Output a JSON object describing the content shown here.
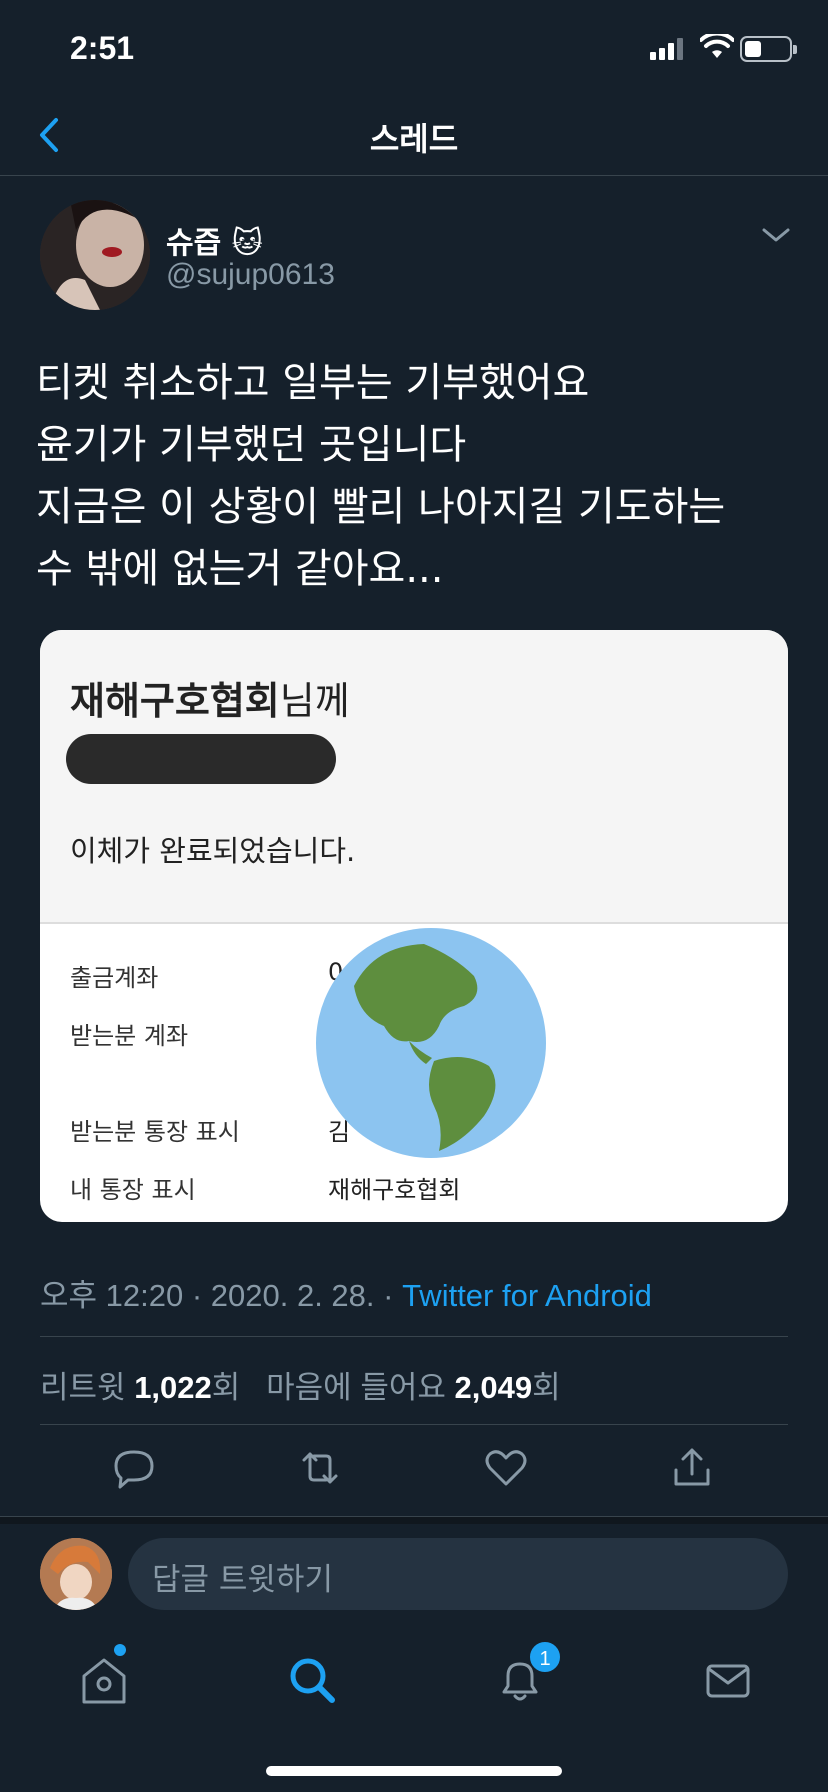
{
  "status_bar": {
    "time": "2:51"
  },
  "nav": {
    "title": "스레드"
  },
  "tweet": {
    "display_name": "슈즙",
    "name_emoji": "🐱",
    "handle": "@sujup0613",
    "text": "티켓 취소하고 일부는 기부했어요\n윤기가 기부했던 곳입니다\n지금은 이 상황이 빨리 나아지길 기도하는\n수 밖에 없는거 같아요...",
    "timestamp": "오후 12:20 · 2020. 2. 28. · ",
    "source": "Twitter for Android",
    "retweets_label": "리트윗",
    "retweets_count": "1,022",
    "retweets_unit": "회",
    "likes_label": "마음에 들어요",
    "likes_count": "2,049",
    "likes_unit": "회"
  },
  "receipt": {
    "recipient_bold": "재해구호협회",
    "recipient_suffix": "님께",
    "completed": "이체가 완료되었습니다.",
    "rows": [
      {
        "label": "출금계좌",
        "value": "0"
      },
      {
        "label": "받는분 계좌",
        "value": ""
      },
      {
        "label": "받는분 통장 표시",
        "value": "김"
      },
      {
        "label": "내 통장 표시",
        "value": "재해구호협회"
      }
    ]
  },
  "reply": {
    "placeholder": "답글 트윗하기"
  },
  "tabbar": {
    "notifications_badge": "1"
  },
  "colors": {
    "background": "#15202b",
    "accent": "#1da1f2",
    "muted": "#8899a6",
    "border": "#38444d"
  }
}
